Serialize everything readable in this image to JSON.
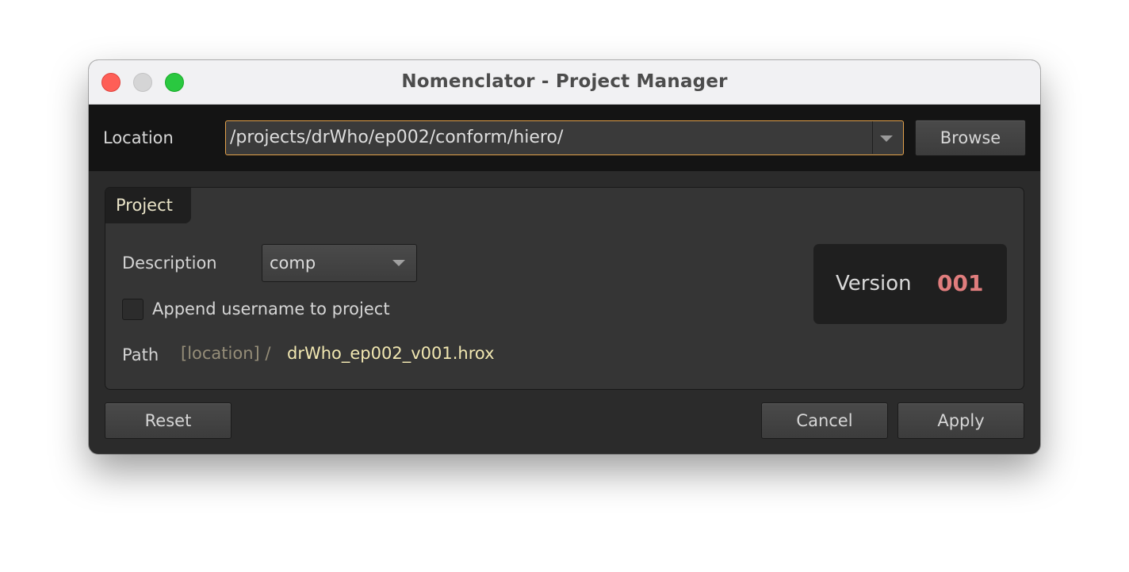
{
  "window": {
    "title": "Nomenclator - Project Manager"
  },
  "location": {
    "label": "Location",
    "value": "/projects/drWho/ep002/conform/hiero/",
    "browse_label": "Browse"
  },
  "project_group": {
    "tab_label": "Project",
    "description": {
      "label": "Description",
      "value": "comp"
    },
    "append_username": {
      "label": "Append username to project",
      "checked": false
    },
    "path": {
      "label": "Path",
      "location_prefix": "[location] /",
      "filename": "drWho_ep002_v001.hrox"
    },
    "version": {
      "label": "Version",
      "value": "001"
    }
  },
  "footer": {
    "reset_label": "Reset",
    "cancel_label": "Cancel",
    "apply_label": "Apply"
  },
  "colors": {
    "focus_border": "#e3a14a",
    "version_accent": "#e07d7d",
    "filename_text": "#f1e7b1",
    "close_button": "#fe5f57",
    "minimize_button": "#d5d5d6",
    "maximize_button": "#2ac840"
  },
  "icons": {
    "location_dropdown": "chevron-down-icon",
    "description_dropdown": "chevron-down-icon"
  }
}
